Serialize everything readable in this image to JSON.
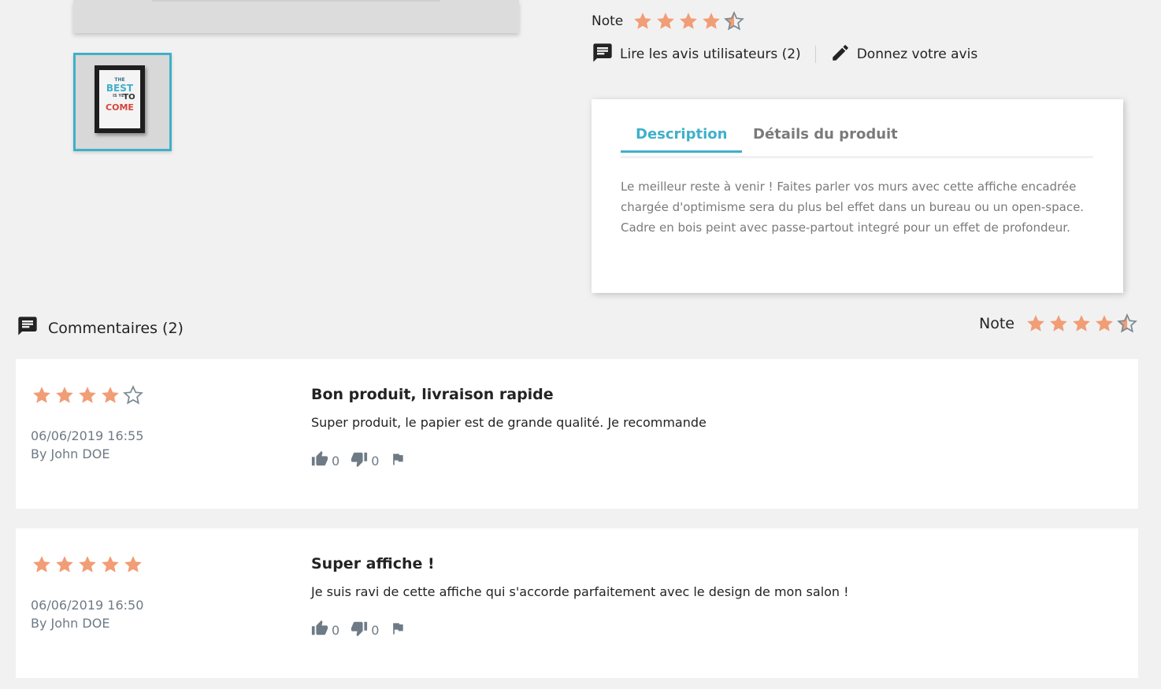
{
  "product": {
    "thumbnail_poster": [
      "THE",
      "BEST",
      "IS YET",
      "TO",
      "COME"
    ],
    "rating_label": "Note",
    "rating_value": 4.5,
    "read_reviews_label": "Lire les avis utilisateurs (2)",
    "write_review_label": "Donnez votre avis"
  },
  "tabs": {
    "items": [
      {
        "label": "Description",
        "active": true
      },
      {
        "label": "Détails du produit",
        "active": false
      }
    ],
    "description_text": "Le meilleur reste à venir ! Faites parler vos murs avec cette affiche encadrée chargée d'optimisme sera du plus bel effet dans un bureau ou un open-space. Cadre en bois peint avec passe-partout integré pour un effet de profondeur."
  },
  "comments": {
    "header_label": "Commentaires (2)",
    "average_label": "Note",
    "average_value": 4.5
  },
  "reviews": [
    {
      "rating": 4,
      "date": "06/06/2019 16:55",
      "author": "By John DOE",
      "title": "Bon produit, livraison rapide",
      "body": "Super produit, le papier est de grande qualité. Je recommande",
      "useful_count": "0",
      "not_useful_count": "0"
    },
    {
      "rating": 5,
      "date": "06/06/2019 16:50",
      "author": "By John DOE",
      "title": "Super affiche !",
      "body": "Je suis ravi de cette affiche qui s'accorde parfaitement avec le design de mon salon !",
      "useful_count": "0",
      "not_useful_count": "0"
    }
  ],
  "colors": {
    "accent": "#3fb0c9",
    "star_filled": "#f19d76",
    "star_empty_stroke": "#7a8a94",
    "background": "#f1f1f1"
  },
  "icons": {
    "comment": "comment-icon",
    "edit": "pencil-icon",
    "thumbs_up": "thumbs-up-icon",
    "thumbs_down": "thumbs-down-icon",
    "report": "flag-icon",
    "star": "star-icon"
  }
}
